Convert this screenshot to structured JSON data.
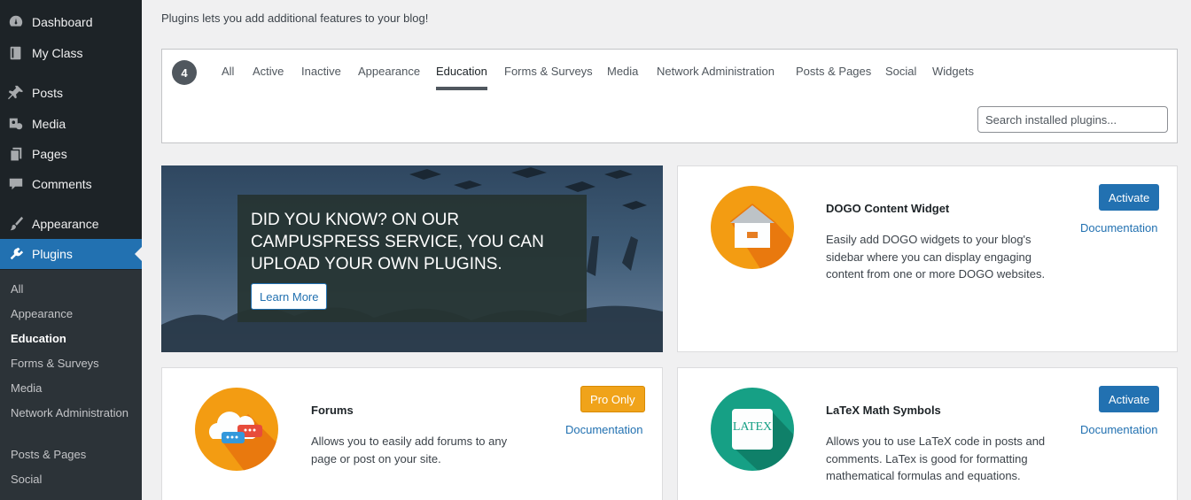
{
  "sidebar": {
    "menu": [
      {
        "label": "Dashboard",
        "icon": "dashboard-icon"
      },
      {
        "label": "My Class",
        "icon": "book-icon"
      },
      {
        "label": "Posts",
        "icon": "pin-icon"
      },
      {
        "label": "Media",
        "icon": "media-icon"
      },
      {
        "label": "Pages",
        "icon": "pages-icon"
      },
      {
        "label": "Comments",
        "icon": "comments-icon"
      },
      {
        "label": "Appearance",
        "icon": "brush-icon"
      },
      {
        "label": "Plugins",
        "icon": "plugin-icon"
      }
    ],
    "submenu": [
      "All",
      "Appearance",
      "Education",
      "Forms & Surveys",
      "Media",
      "Network Administration",
      "Posts & Pages",
      "Social"
    ]
  },
  "intro_text": "Plugins lets you add additional features to your blog!",
  "filter": {
    "count": "4",
    "tabs": [
      "All",
      "Active",
      "Inactive",
      "Appearance",
      "Education",
      "Forms & Surveys",
      "Media",
      "Network Administration",
      "Posts & Pages",
      "Social",
      "Widgets"
    ],
    "current_tab": "Education",
    "search_placeholder": "Search installed plugins..."
  },
  "banner": {
    "text": "DID YOU KNOW? ON OUR CAMPUSPRESS SERVICE, YOU CAN UPLOAD YOUR OWN PLUGINS.",
    "button": "Learn More"
  },
  "plugins": [
    {
      "name": "DOGO Content Widget",
      "description": "Easily add DOGO widgets to your blog's sidebar where you can display engaging content from one or more DOGO websites.",
      "action": "Activate",
      "doc": "Documentation",
      "icon": "house-icon"
    },
    {
      "name": "Forums",
      "description": "Allows you to easily add forums to any page or post on your site.",
      "action": "Pro Only",
      "doc": "Documentation",
      "icon": "cloud-chat-icon"
    },
    {
      "name": "LaTeX Math Symbols",
      "description": "Allows you to use LaTeX code in posts and comments. LaTex is good for formatting mathematical formulas and equations.",
      "action": "Activate",
      "doc": "Documentation",
      "icon": "latex-icon",
      "icon_text": "LATEX"
    }
  ],
  "colors": {
    "sidebar": "#1d2327",
    "accent": "#2271b1",
    "orange": "#f39c12",
    "teal": "#16a085",
    "pro": "#f0a31a"
  }
}
